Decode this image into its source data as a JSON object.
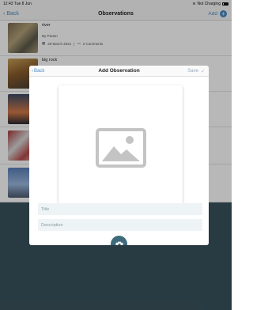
{
  "status_bar": {
    "time": "12:43",
    "date": "Tue 8 Jun",
    "charging": "Not Charging"
  },
  "nav": {
    "back_label": "Back",
    "title": "Observations",
    "add_label": "Add"
  },
  "observations": [
    {
      "title": "river",
      "author": "By Param",
      "date": "29 March 2021",
      "comments": "2 Comments"
    },
    {
      "title": "big rock"
    }
  ],
  "modal": {
    "back_label": "Back",
    "title": "Add Observation",
    "save_label": "Save",
    "title_placeholder": "Title",
    "description_placeholder": "Description"
  },
  "icons": {
    "back": "chevron-left-icon",
    "add": "plus-circle-icon",
    "save": "checkmark-icon",
    "image_placeholder": "image-placeholder-icon",
    "camera": "camera-icon",
    "calendar": "calendar-icon",
    "comment": "comment-icon"
  },
  "colors": {
    "accent": "#4a8ac4",
    "camera_button": "#3d6b7b",
    "backdrop": "#3a535c"
  }
}
